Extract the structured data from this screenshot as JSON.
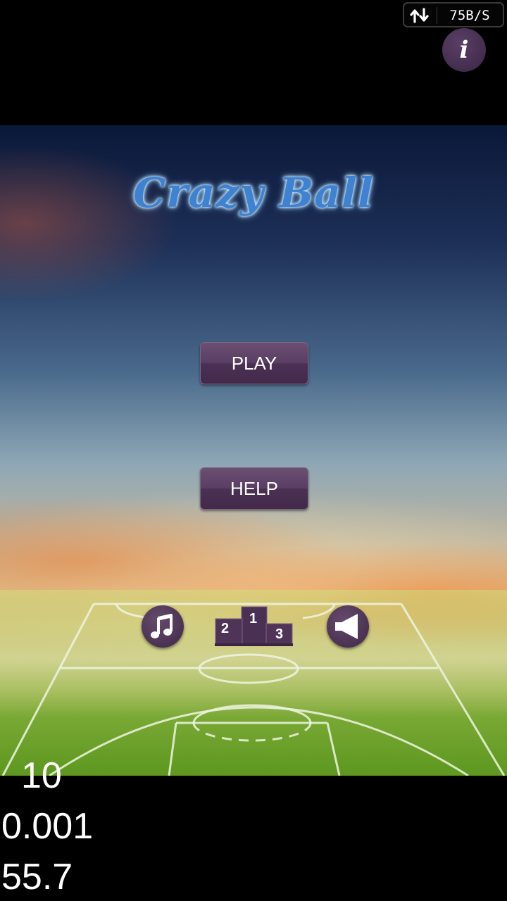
{
  "status": {
    "network_rate": "75B/S",
    "network_icon": "updown-arrows-icon"
  },
  "info_button": {
    "label": "i",
    "icon": "info-icon"
  },
  "game": {
    "title": "Crazy Ball",
    "buttons": {
      "play": "PLAY",
      "help": "HELP"
    },
    "toolbar": {
      "music_icon": "music-note-icon",
      "leaderboard_icon": "podium-icon",
      "podium_labels": [
        "2",
        "1",
        "3"
      ],
      "sound_icon": "speaker-icon"
    }
  },
  "debug": {
    "line1": "10",
    "line2": "0.001",
    "line3": "55.7"
  },
  "colors": {
    "button": "#553a5e",
    "title": "#3f82d1",
    "grass": "#6aa52a"
  }
}
